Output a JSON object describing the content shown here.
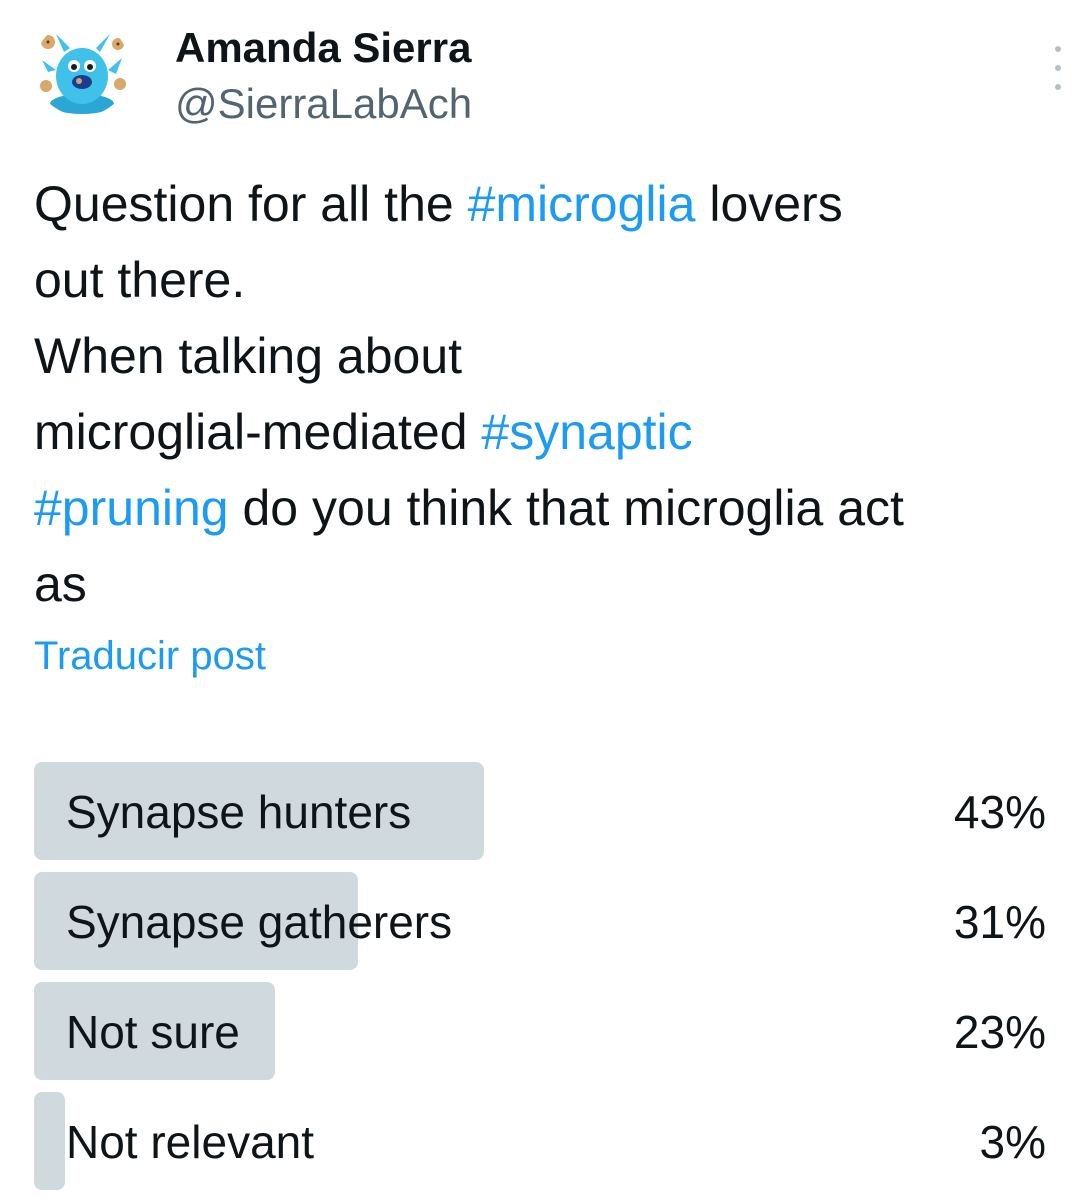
{
  "author": {
    "display_name": "Amanda Sierra",
    "handle": "@SierraLabAch",
    "avatar_icon": "blue-microglia-cartoon-avatar-icon"
  },
  "post": {
    "lines": [
      [
        {
          "text": "Question for all the ",
          "tag": false
        },
        {
          "text": "#microglia",
          "tag": true
        },
        {
          "text": " lovers",
          "tag": false
        }
      ],
      [
        {
          "text": "out there.",
          "tag": false
        }
      ],
      [
        {
          "text": "When talking about",
          "tag": false
        }
      ],
      [
        {
          "text": "microglial-mediated ",
          "tag": false
        },
        {
          "text": "#synaptic",
          "tag": true
        }
      ],
      [
        {
          "text": "#pruning",
          "tag": true
        },
        {
          "text": " do you think that microglia act",
          "tag": false
        }
      ],
      [
        {
          "text": "as",
          "tag": false
        }
      ]
    ],
    "translate_label": "Traducir post"
  },
  "poll": {
    "options": [
      {
        "label": "Synapse hunters",
        "percent_label": "43%",
        "percent": 43
      },
      {
        "label": "Synapse gatherers",
        "percent_label": "31%",
        "percent": 31
      },
      {
        "label": "Not sure",
        "percent_label": "23%",
        "percent": 23
      },
      {
        "label": "Not relevant",
        "percent_label": "3%",
        "percent": 3
      }
    ]
  },
  "colors": {
    "link": "#1d9bf0",
    "bar": "#cfd9de",
    "text": "#0f1419",
    "secondary": "#536471"
  }
}
